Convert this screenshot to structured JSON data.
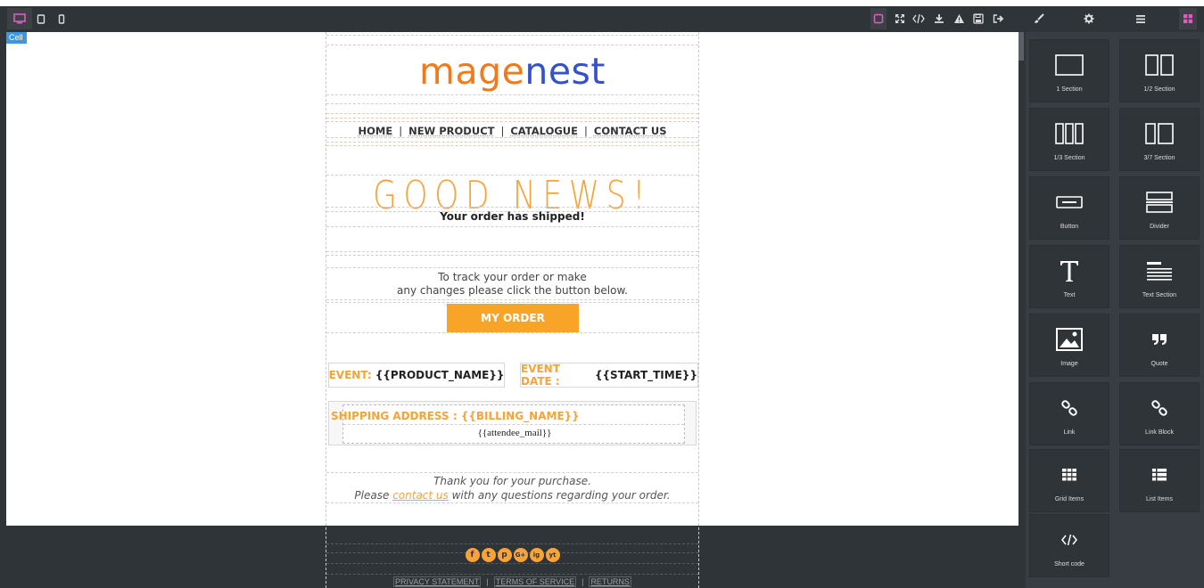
{
  "toolbar": {
    "device_buttons": [
      "desktop-icon",
      "tablet-icon",
      "mobile-icon"
    ],
    "action_buttons": [
      "outline-icon",
      "fullscreen-icon",
      "code-icon",
      "download-icon",
      "warning-icon",
      "save-icon",
      "exit-icon"
    ],
    "panel_buttons": [
      "brush-icon",
      "gear-icon",
      "menu-icon",
      "blocks-icon"
    ],
    "accent": "#e05cc0"
  },
  "canvas": {
    "badge": "Cell"
  },
  "email": {
    "logo_part1": "mag",
    "logo_part2": "e",
    "logo_part3": "nest",
    "nav": [
      "HOME",
      "NEW PRODUCT",
      "CATALOGUE",
      "CONTACT US"
    ],
    "nav_separator": "|",
    "headline": "GOOD NEWS!",
    "subheadline": "Your order has shipped!",
    "track_line1": "To track your order or make",
    "track_line2": "any changes please click the button below.",
    "button": "MY ORDER",
    "event_label": "EVENT:",
    "event_value": "{{PRODUCT_NAME}}",
    "event_date_label": "EVENT DATE :",
    "event_date_value": "{{START_TIME}}",
    "shipping_label": "SHIPPING ADDRESS :  {{BILLING_NAME}}",
    "shipping_mail": "{{attendee_mail}}",
    "thanks_line1": "Thank you for your purchase.",
    "thanks_pre": "Please ",
    "thanks_link": "contact us",
    "thanks_post": " with any questions regarding your order.",
    "social": [
      "f",
      "t",
      "p",
      "G+",
      "ig",
      "yt"
    ],
    "footer_links": [
      "PRIVACY STATEMENT",
      "TERMS OF SERVICE",
      "RETURNS"
    ],
    "colors": {
      "orange": "#f6a338",
      "button": "#f8a428",
      "logo_orange": "#f27a1a",
      "logo_blue": "#3652c9"
    }
  },
  "panel": {
    "blocks": [
      {
        "label": "1 Section",
        "icon": "one-section-icon"
      },
      {
        "label": "1/2 Section",
        "icon": "half-section-icon"
      },
      {
        "label": "1/3 Section",
        "icon": "third-section-icon"
      },
      {
        "label": "3/7 Section",
        "icon": "three-seven-section-icon"
      },
      {
        "label": "Button",
        "icon": "button-icon"
      },
      {
        "label": "Divider",
        "icon": "divider-icon"
      },
      {
        "label": "Text",
        "icon": "text-icon"
      },
      {
        "label": "Text Section",
        "icon": "text-section-icon"
      },
      {
        "label": "Image",
        "icon": "image-icon"
      },
      {
        "label": "Quote",
        "icon": "quote-icon"
      },
      {
        "label": "Link",
        "icon": "link-icon"
      },
      {
        "label": "Link Block",
        "icon": "link-block-icon"
      },
      {
        "label": "Grid Items",
        "icon": "grid-items-icon"
      },
      {
        "label": "List Items",
        "icon": "list-items-icon"
      },
      {
        "label": "Short code",
        "icon": "short-code-icon"
      }
    ]
  }
}
